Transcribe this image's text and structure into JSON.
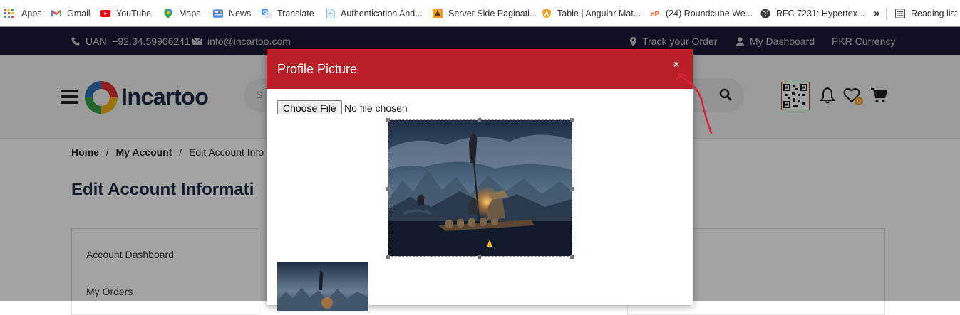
{
  "bookmarks": [
    {
      "label": "Apps",
      "icon": "apps-grid-icon"
    },
    {
      "label": "Gmail",
      "icon": "gmail-icon"
    },
    {
      "label": "YouTube",
      "icon": "youtube-icon"
    },
    {
      "label": "Maps",
      "icon": "maps-icon"
    },
    {
      "label": "News",
      "icon": "news-icon"
    },
    {
      "label": "Translate",
      "icon": "translate-icon"
    },
    {
      "label": "Authentication And...",
      "icon": "bookmark-site-icon"
    },
    {
      "label": "Server Side Paginati...",
      "icon": "bookmark-site-icon"
    },
    {
      "label": "Table | Angular Mat...",
      "icon": "angular-icon"
    },
    {
      "label": "(24) Roundcube We...",
      "icon": "cpanel-icon"
    },
    {
      "label": "RFC 7231: Hypertex...",
      "icon": "globe-icon"
    }
  ],
  "bookmarks_overflow": "»",
  "reading_list": "Reading list",
  "topbar": {
    "uan": "UAN: +92.34.59966241",
    "email": "info@incartoo.com",
    "track": "Track your Order",
    "dashboard": "My Dashboard",
    "currency": "PKR Currency"
  },
  "header": {
    "logo": "Incartoo",
    "search_placeholder": "S"
  },
  "breadcrumb": {
    "home": "Home",
    "sep": "/",
    "account": "My Account",
    "current": "Edit Account Info"
  },
  "page_title": "Edit Account Informati",
  "sidebar": {
    "items": [
      {
        "label": "Account Dashboard"
      },
      {
        "label": "My Orders"
      }
    ]
  },
  "modal": {
    "title": "Profile Picture",
    "close": "×",
    "choose_file": "Choose File",
    "file_status": "No file chosen"
  },
  "colors": {
    "modal_header": "#b91f26",
    "topbar": "#1c1836",
    "annotation": "#d8243a"
  }
}
